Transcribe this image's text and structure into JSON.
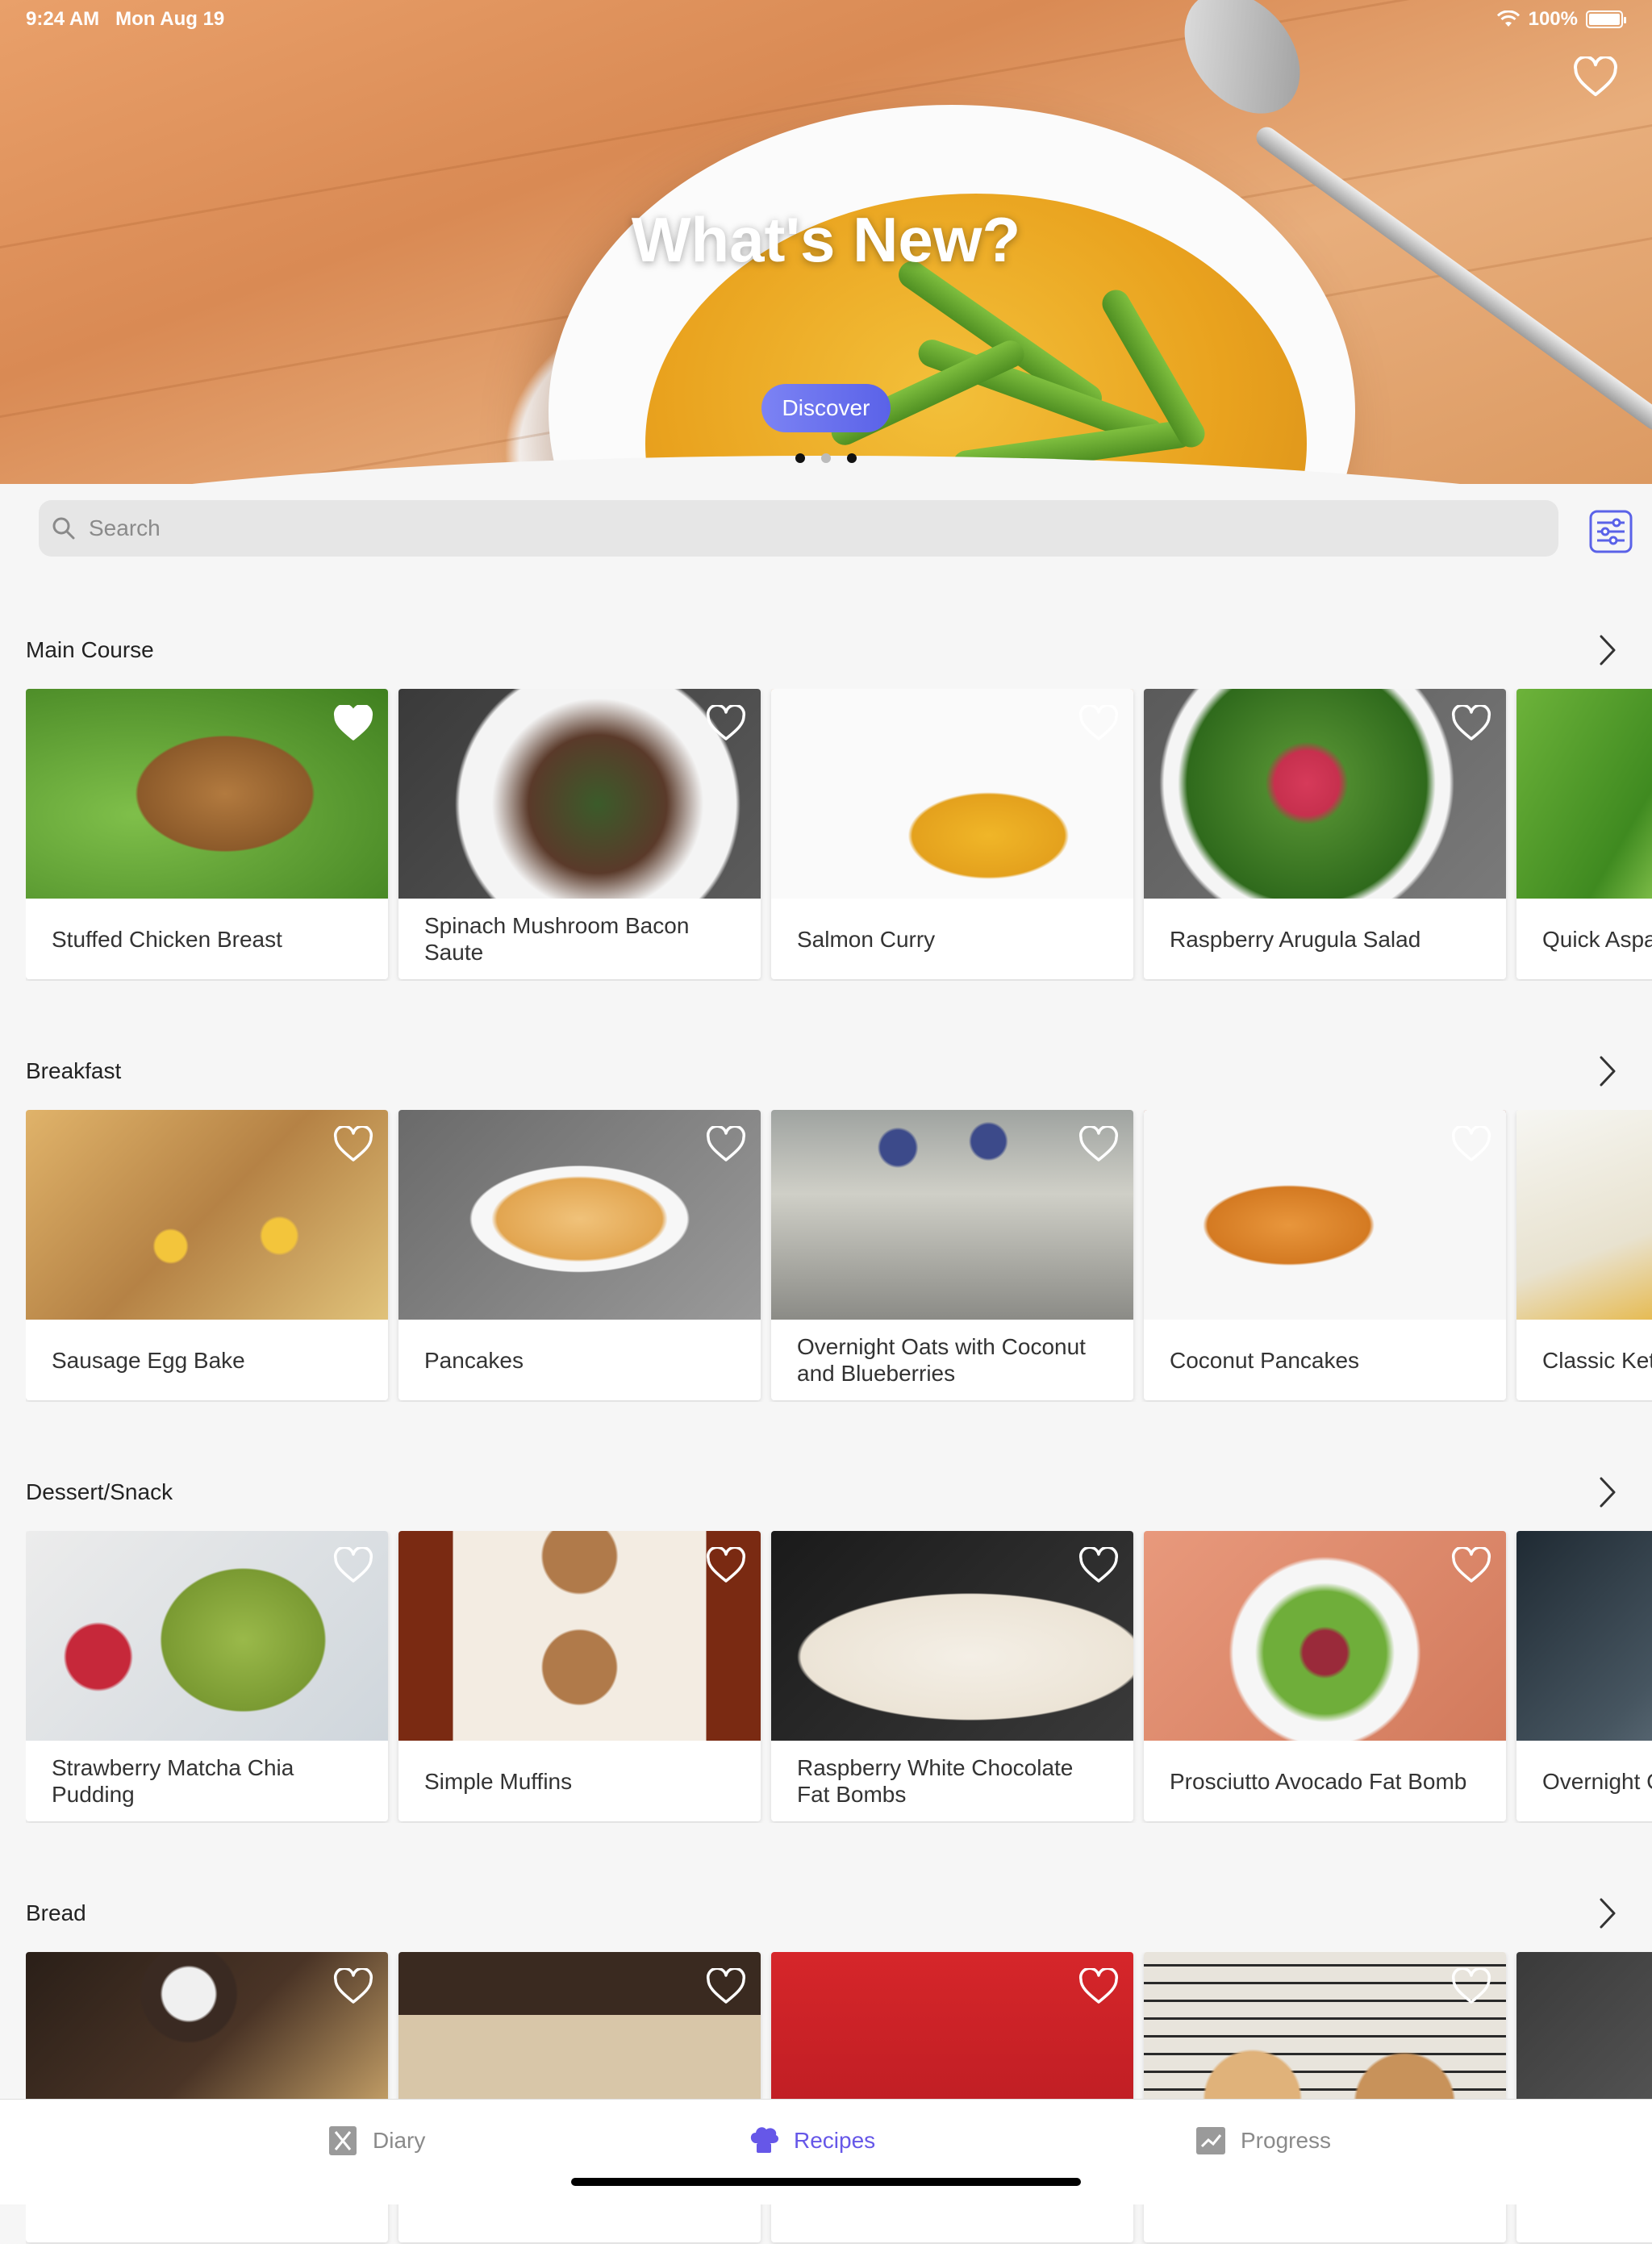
{
  "status_bar": {
    "time": "9:24 AM",
    "date": "Mon Aug 19",
    "battery": "100%"
  },
  "hero": {
    "title": "What's New?",
    "button_label": "Discover",
    "pages": 3,
    "active_page": 1
  },
  "search": {
    "placeholder": "Search"
  },
  "sections": [
    {
      "title": "Main Course",
      "items": [
        {
          "name": "Stuffed Chicken Breast",
          "favorited": true
        },
        {
          "name": "Spinach Mushroom Bacon Saute",
          "favorited": false
        },
        {
          "name": "Salmon Curry",
          "favorited": false
        },
        {
          "name": "Raspberry Arugula Salad",
          "favorited": false
        },
        {
          "name": "Quick Aspa",
          "favorited": false
        }
      ]
    },
    {
      "title": "Breakfast",
      "items": [
        {
          "name": "Sausage Egg Bake",
          "favorited": false
        },
        {
          "name": "Pancakes",
          "favorited": false
        },
        {
          "name": "Overnight Oats with Coconut and Blueberries",
          "favorited": false
        },
        {
          "name": "Coconut Pancakes",
          "favorited": false
        },
        {
          "name": "Classic Ket",
          "favorited": false
        }
      ]
    },
    {
      "title": "Dessert/Snack",
      "items": [
        {
          "name": "Strawberry Matcha Chia Pudding",
          "favorited": false
        },
        {
          "name": "Simple Muffins",
          "favorited": false
        },
        {
          "name": "Raspberry White Chocolate Fat Bombs",
          "favorited": false
        },
        {
          "name": "Prosciutto Avocado Fat Bomb",
          "favorited": false
        },
        {
          "name": "Overnight C and Bluebe",
          "favorited": false
        }
      ]
    },
    {
      "title": "Bread",
      "items": [
        {
          "name": "",
          "favorited": false
        },
        {
          "name": "",
          "favorited": false
        },
        {
          "name": "",
          "favorited": false
        },
        {
          "name": "",
          "favorited": false
        },
        {
          "name": "",
          "favorited": false
        }
      ]
    }
  ],
  "tabs": [
    {
      "label": "Diary",
      "icon": "diary-icon",
      "active": false
    },
    {
      "label": "Recipes",
      "icon": "chef-hat-icon",
      "active": true
    },
    {
      "label": "Progress",
      "icon": "progress-icon",
      "active": false
    }
  ],
  "colors": {
    "accent": "#6657e8",
    "background": "#f6f6f6"
  }
}
